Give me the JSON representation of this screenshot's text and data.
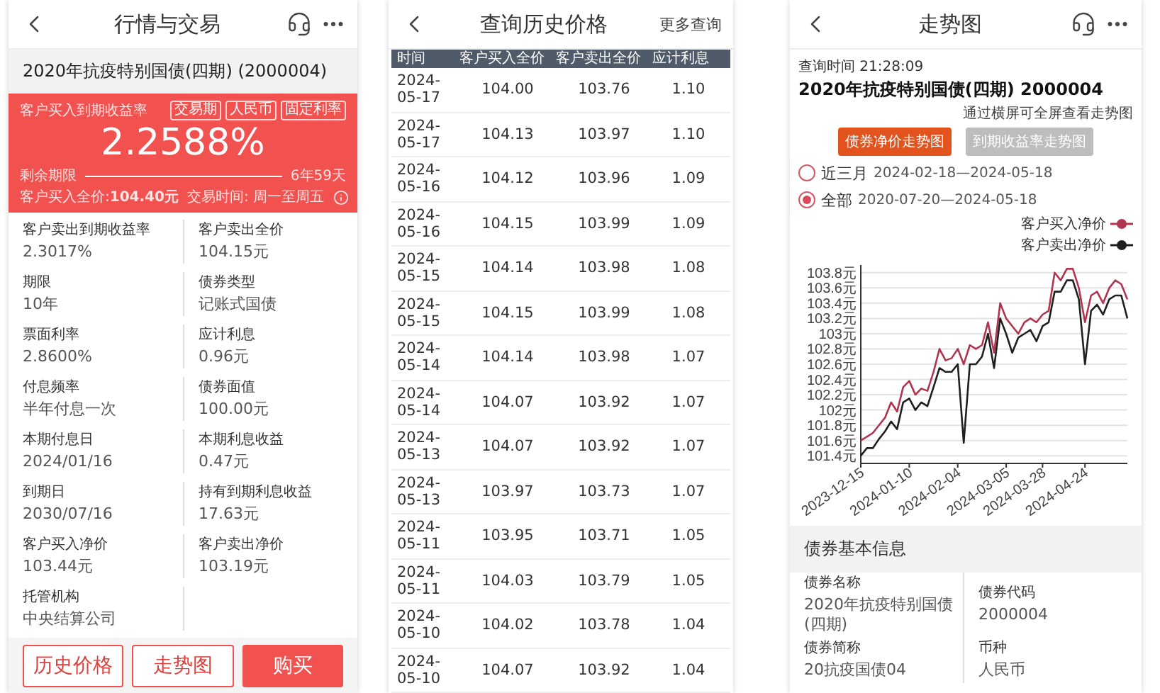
{
  "trade_screen": {
    "title": "行情与交易",
    "bond_heading": "2020年抗疫特别国债(四期) (2000004)",
    "yield_card": {
      "label": "客户买入到期收益率",
      "tags": [
        "交易期",
        "人民币",
        "固定利率"
      ],
      "value": "2.2588%",
      "term_label": "剩余期限",
      "term_value": "6年59天",
      "price": "客户买入全价:**104.40元**",
      "trade_time": "交易时间: 周一至周五"
    },
    "fields": [
      {
        "label": "客户卖出到期收益率",
        "value": "2.3017%"
      },
      {
        "label": "客户卖出全价",
        "value": "104.15元"
      },
      {
        "label": "期限",
        "value": "10年"
      },
      {
        "label": "债券类型",
        "value": "记账式国债"
      },
      {
        "label": "票面利率",
        "value": "2.8600%"
      },
      {
        "label": "应计利息",
        "value": "0.96元"
      },
      {
        "label": "付息频率",
        "value": "半年付息一次"
      },
      {
        "label": "债券面值",
        "value": "100.00元"
      },
      {
        "label": "本期付息日",
        "value": "2024/01/16"
      },
      {
        "label": "本期利息收益",
        "value": "0.47元"
      },
      {
        "label": "到期日",
        "value": "2030/07/16"
      },
      {
        "label": "持有到期利息收益",
        "value": "17.63元"
      },
      {
        "label": "客户买入净价",
        "value": "103.44元"
      },
      {
        "label": "客户卖出净价",
        "value": "103.19元"
      },
      {
        "label": "托管机构",
        "value": "中央结算公司"
      }
    ],
    "buttons": [
      {
        "label": "历史价格",
        "kind": "outline"
      },
      {
        "label": "走势图",
        "kind": "outline"
      },
      {
        "label": "购买",
        "kind": "primary"
      }
    ]
  },
  "history_screen": {
    "title": "查询历史价格",
    "more_link": "更多查询",
    "table": {
      "columns": [
        "时间",
        "客户买入全价",
        "客户卖出全价",
        "应计利息"
      ],
      "rows": [
        [
          "2024-05-17",
          "104.00",
          "103.76",
          "1.10"
        ],
        [
          "2024-05-17",
          "104.13",
          "103.97",
          "1.10"
        ],
        [
          "2024-05-16",
          "104.12",
          "103.96",
          "1.09"
        ],
        [
          "2024-05-16",
          "104.15",
          "103.99",
          "1.09"
        ],
        [
          "2024-05-15",
          "104.14",
          "103.98",
          "1.08"
        ],
        [
          "2024-05-15",
          "104.15",
          "103.99",
          "1.08"
        ],
        [
          "2024-05-14",
          "104.14",
          "103.98",
          "1.07"
        ],
        [
          "2024-05-14",
          "104.07",
          "103.92",
          "1.07"
        ],
        [
          "2024-05-13",
          "104.07",
          "103.92",
          "1.07"
        ],
        [
          "2024-05-13",
          "103.97",
          "103.73",
          "1.07"
        ],
        [
          "2024-05-11",
          "103.95",
          "103.71",
          "1.05"
        ],
        [
          "2024-05-11",
          "104.03",
          "103.79",
          "1.05"
        ],
        [
          "2024-05-10",
          "104.02",
          "103.78",
          "1.04"
        ],
        [
          "2024-05-10",
          "104.07",
          "103.92",
          "1.04"
        ]
      ]
    }
  },
  "chart_screen": {
    "title": "走势图",
    "query_time": "查询时间 21:28:09",
    "bond_title": "2020年抗疫特别国债(四期) 2000004",
    "hint": "通过横屏可全屏查看走势图",
    "tabs": [
      {
        "label": "债券净价走势图",
        "selected": true
      },
      {
        "label": "到期收益率走势图",
        "selected": false
      }
    ],
    "ranges": [
      {
        "label": "近三月",
        "dates": "2024-02-18—2024-05-18",
        "selected": false
      },
      {
        "label": "全部",
        "dates": "2020-07-20—2024-05-18",
        "selected": true
      }
    ],
    "chart_data": {
      "type": "line",
      "categories": [
        "2023-12-15",
        null,
        null,
        null,
        null,
        null,
        null,
        null,
        "2024-01-10",
        null,
        null,
        null,
        null,
        null,
        null,
        null,
        "2024-02-04",
        null,
        null,
        null,
        null,
        null,
        null,
        null,
        "2024-03-05",
        null,
        null,
        null,
        null,
        null,
        "2024-03-28",
        null,
        null,
        null,
        null,
        null,
        null,
        "2024-04-24",
        null,
        null,
        null,
        null,
        null,
        null,
        null
      ],
      "series": [
        {
          "name": "客户买入净价",
          "color": "#b0364f",
          "values": [
            101.6,
            101.65,
            101.7,
            101.8,
            101.9,
            102.1,
            101.98,
            102.3,
            102.38,
            102.2,
            102.28,
            102.25,
            102.5,
            102.8,
            102.65,
            102.68,
            102.8,
            102.6,
            102.85,
            102.8,
            102.85,
            103.15,
            102.75,
            103.4,
            103.2,
            103.1,
            103.0,
            103.15,
            103.2,
            103.15,
            103.25,
            103.3,
            103.8,
            103.7,
            103.85,
            103.85,
            103.6,
            103.15,
            103.5,
            103.55,
            103.4,
            103.6,
            103.7,
            103.65,
            103.45
          ]
        },
        {
          "name": "客户卖出净价",
          "color": "#1f1f1f",
          "values": [
            101.4,
            101.5,
            101.5,
            101.62,
            101.72,
            101.85,
            101.75,
            102.1,
            102.15,
            102.0,
            102.1,
            102.05,
            102.3,
            102.55,
            102.5,
            102.5,
            102.6,
            101.57,
            102.6,
            102.6,
            102.7,
            103.0,
            102.55,
            103.2,
            103.0,
            102.75,
            102.95,
            103.0,
            103.05,
            102.9,
            103.1,
            103.15,
            103.55,
            103.55,
            103.7,
            103.7,
            103.45,
            102.6,
            103.3,
            103.38,
            103.25,
            103.45,
            103.5,
            103.5,
            103.2
          ]
        }
      ],
      "ylim": [
        101.3,
        103.9
      ],
      "grid": true,
      "yticks": [
        {
          "value": 101.4,
          "label": "101.4元"
        },
        {
          "value": 101.6,
          "label": "101.6元"
        },
        {
          "value": 101.8,
          "label": "101.8元"
        },
        {
          "value": 102,
          "label": "102元"
        },
        {
          "value": 102.2,
          "label": "102.2元"
        },
        {
          "value": 102.4,
          "label": "102.4元"
        },
        {
          "value": 102.6,
          "label": "102.6元"
        },
        {
          "value": 102.8,
          "label": "102.8元"
        },
        {
          "value": 103,
          "label": "103元"
        },
        {
          "value": 103.2,
          "label": "103.2元"
        },
        {
          "value": 103.4,
          "label": "103.4元"
        },
        {
          "value": 103.6,
          "label": "103.6元"
        },
        {
          "value": 103.8,
          "label": "103.8元"
        }
      ]
    },
    "info_heading": "债券基本信息",
    "info": [
      {
        "label": "债券名称",
        "value": "2020年抗疫特别国债(四期)"
      },
      {
        "label": "债券代码",
        "value": "2000004"
      },
      {
        "label": "债券简称",
        "value": "20抗疫国债04"
      },
      {
        "label": "币种",
        "value": "人民币"
      }
    ]
  }
}
